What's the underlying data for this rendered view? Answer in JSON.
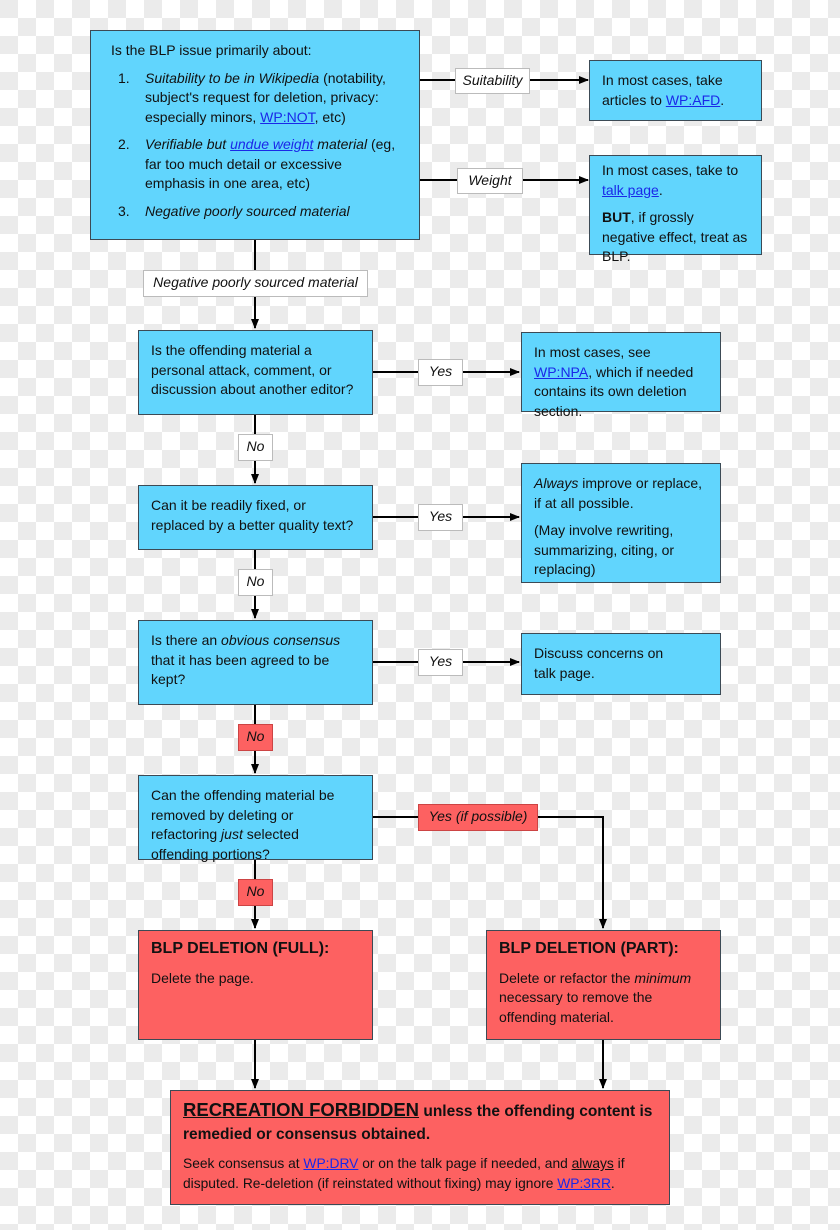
{
  "colors": {
    "blue": "#61d5fd",
    "red": "#fd6161",
    "link": "#1a28e8"
  },
  "top": {
    "question": "Is the BLP issue primarily about:",
    "items": [
      {
        "num": "1.",
        "em": "Suitability to be in Wikipedia",
        "text1": " (notability, subject's request for deletion, privacy: especially minors, ",
        "link": "WP:NOT",
        "text2": ", etc)"
      },
      {
        "num": "2.",
        "em": "Verifiable but ",
        "link": "undue weight",
        "em2": " material",
        "text1": " (eg, far too much detail or excessive emphasis in one area, etc)"
      },
      {
        "num": "3.",
        "em": "Negative poorly sourced material"
      }
    ]
  },
  "labels": {
    "suitability": "Suitability",
    "weight": "Weight",
    "negative": "Negative poorly sourced material",
    "yes": "Yes",
    "no": "No",
    "yes_possible": "Yes (if possible)"
  },
  "afd": {
    "text1": "In most cases, take articles to ",
    "link": "WP:AFD",
    "text2": "."
  },
  "talk": {
    "text1": "In most cases, take to ",
    "link": "talk page",
    "text2": ".",
    "bold": "BUT",
    "text3": ", if grossly negative effect, treat as BLP."
  },
  "q1": {
    "text": "Is the offending material a personal attack, comment, or discussion about another editor?"
  },
  "npa": {
    "text1": "In most cases, see ",
    "link": "WP:NPA",
    "text2": ", which if needed contains its own deletion section."
  },
  "q2": {
    "text": "Can it be readily fixed, or replaced by a better quality text?"
  },
  "improve": {
    "em": "Always",
    "text1": " improve or replace, if at all possible.",
    "text2": "(May involve rewriting, summarizing, citing, or replacing)"
  },
  "q3": {
    "text1": "Is there an ",
    "em": "obvious consensus",
    "text2": " that it has been agreed to be kept?"
  },
  "discuss": {
    "text": "Discuss concerns on talk page."
  },
  "q4": {
    "text1": "Can the offending material be removed by deleting or refactoring ",
    "em": "just",
    "text2": " selected offending portions?"
  },
  "full": {
    "title": "BLP DELETION (FULL):",
    "text": "Delete the page."
  },
  "part": {
    "title": "BLP DELETION (PART):",
    "text1": "Delete or refactor the ",
    "em": "minimum",
    "text2": " necessary to remove the offending material."
  },
  "final": {
    "title_u": "RECREATION FORBIDDEN",
    "title_rest": " unless the offending content is remedied or consensus obtained.",
    "t1": "Seek consensus at ",
    "l1": "WP:DRV",
    "t2": " or on the talk page if needed, and ",
    "u": "always",
    "t3": " if disputed. Re-deletion (if reinstated without fixing) may ignore ",
    "l2": "WP:3RR",
    "t4": "."
  }
}
